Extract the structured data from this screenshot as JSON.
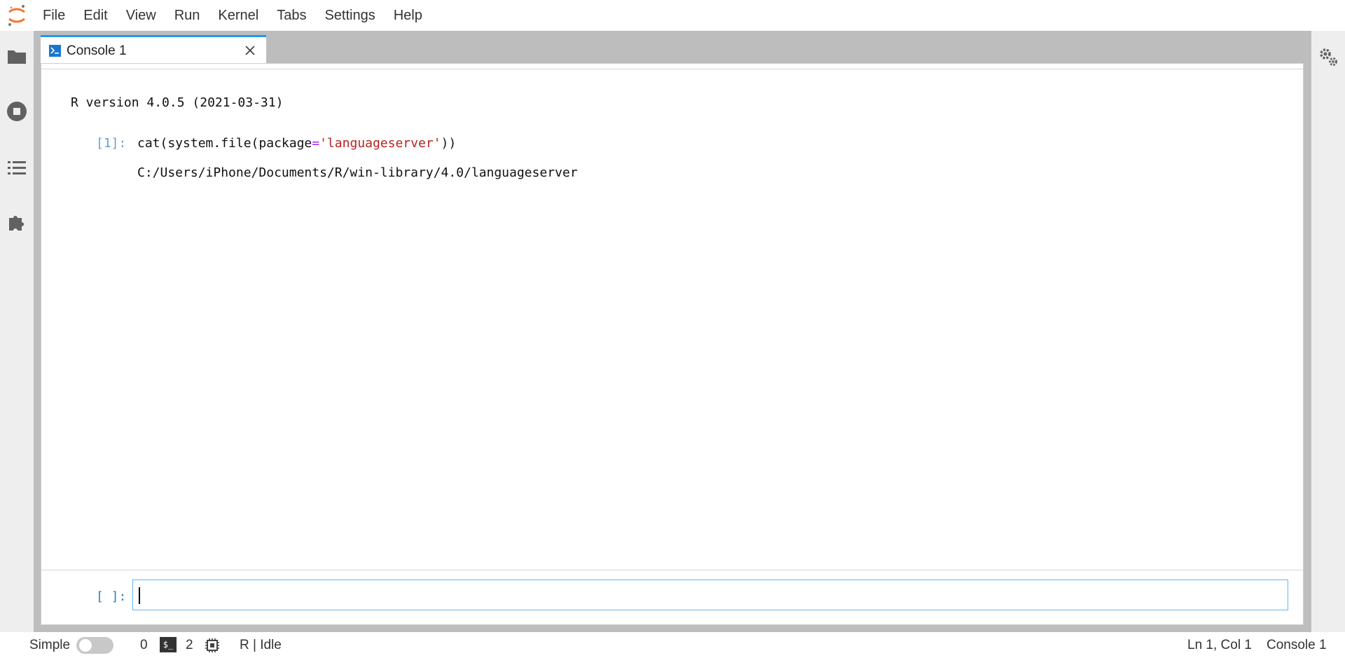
{
  "menubar": {
    "logo_icon": "jupyter-logo-icon",
    "items": [
      "File",
      "Edit",
      "View",
      "Run",
      "Kernel",
      "Tabs",
      "Settings",
      "Help"
    ]
  },
  "left_sidebar": {
    "icons": [
      "folder-icon",
      "running-stop-icon",
      "table-of-contents-icon",
      "extension-puzzle-icon"
    ]
  },
  "right_sidebar": {
    "icons": [
      "property-inspector-gears-icon"
    ]
  },
  "tab": {
    "label": "Console 1",
    "icon": "console-icon",
    "close_icon": "close-icon",
    "accent_color": "#2196f3"
  },
  "console": {
    "banner": "R version 4.0.5 (2021-03-31)",
    "cells": [
      {
        "prompt": "[1]:",
        "code_parts": [
          "cat(system.file(package",
          "=",
          "'languageserver'",
          "))"
        ],
        "output": "C:/Users/iPhone/Documents/R/win-library/4.0/languageserver"
      }
    ],
    "input_prompt": "[ ]:",
    "input_value": ""
  },
  "statusbar": {
    "mode_label": "Simple",
    "simple_toggle_on": false,
    "terminals_count": "0",
    "terminal_badge": "$_",
    "kernels_count": "2",
    "kernel_status": "R | Idle",
    "cursor_position": "Ln 1, Col 1",
    "active_document": "Console 1"
  }
}
